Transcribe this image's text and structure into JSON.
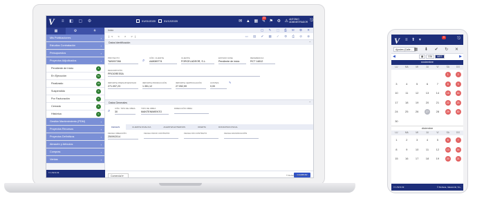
{
  "laptop": {
    "logo": "V",
    "toolbar_icons": "≡ ◧ ▢ ⚙",
    "date_from": "01/01/2020",
    "date_to": "31/12/2020",
    "notifications_badge": "23",
    "user_name": "ANTONIO",
    "user_role": "ADMINISTRADOR",
    "side_tabs": [
      "▦",
      "⚙",
      "⚘"
    ],
    "menu": [
      {
        "label": "Mis Publicaciones",
        "type": "grp"
      },
      {
        "label": "Estudios Contratación",
        "type": "grp"
      },
      {
        "label": "Presupuestos",
        "type": "grp"
      },
      {
        "label": "Proyectos Adjudicados",
        "type": "grp"
      },
      {
        "label": "Pendiente de Inicio",
        "type": "sub",
        "count": "4",
        "color": "#2e7d32"
      },
      {
        "label": "En Ejecución",
        "type": "sub",
        "count": "51",
        "color": "#2e7d32"
      },
      {
        "label": "Finalizado",
        "type": "sub",
        "count": "23",
        "color": "#2e7d32"
      },
      {
        "label": "Suspendido",
        "type": "sub",
        "count": "0",
        "color": "#2e7d32"
      },
      {
        "label": "Por Facturación",
        "type": "sub",
        "count": "0",
        "color": "#2e7d32"
      },
      {
        "label": "Cerrada",
        "type": "sub",
        "count": "3",
        "color": "#2e7d32"
      },
      {
        "label": "Histórica",
        "type": "sub",
        "count": "0",
        "color": "#2e7d32"
      },
      {
        "label": "Gestión Mantenimiento (PDM)",
        "type": "grp"
      },
      {
        "label": "Proyectos Recursos",
        "type": "grp"
      },
      {
        "label": "Proyectos Definitivos",
        "type": "grp"
      },
      {
        "label": "Almacén y Artículos",
        "type": "grp"
      },
      {
        "label": "Compras",
        "type": "grp"
      },
      {
        "label": "Ventas",
        "type": "grp"
      }
    ],
    "side_footer": "V 1.52.0.19",
    "breadcrumb": "Inicio",
    "nav_pager": "|< < > >|",
    "section_1": "Datos Identificación",
    "fields_1": [
      {
        "label": "PROYECTO",
        "value": "TAB007266"
      },
      {
        "label": "CÓD. CLIENTE",
        "value": "A48089774"
      },
      {
        "label": "CLIENTE",
        "value": "FORCELADEOR, S.L."
      },
      {
        "label": "ESTADO FASE",
        "value": "Pendiente de inicio"
      },
      {
        "label": "REFERENCIA",
        "value": "RCT 14812"
      },
      {
        "label": "DESCRIPCIÓN",
        "value": "PROGRESSA"
      },
      {
        "label": "IMPORTE PRESUPUESTADO",
        "value": "271.097,23"
      },
      {
        "label": "IMPORTE PRODUCCIÓN",
        "value": "1.351,12"
      },
      {
        "label": "IMPORTE CERTIFICACIÓN",
        "value": "27.052,59"
      },
      {
        "label": "COSTES",
        "value": "0,00"
      }
    ],
    "section_2": "Datos Generales",
    "fields_2": [
      {
        "label": "CÓD. TIPO DE OBRA",
        "value": "30"
      },
      {
        "label": "TIPO DE OBRA",
        "value": "MANTENIMIENTO"
      },
      {
        "label": "DIRECCIÓN OBRA",
        "value": ""
      }
    ],
    "subtabs": [
      "FECHAS",
      "CLIENTE FINAL/OA",
      "AGENTES EXTERNOS",
      "OFERTA",
      "DONANTES FISCAL"
    ],
    "fields_3": [
      {
        "label": "FECHA CREACIÓN",
        "value": "25/09/2014"
      },
      {
        "label": "FECHA INICIO CONTRATO",
        "value": ""
      },
      {
        "label": "FECHA FIN CONTRATO",
        "value": ""
      },
      {
        "label": "FECHA ADJUDICACIÓN",
        "value": ""
      }
    ],
    "bottom_select": "Comercial",
    "bottom_button": "GUARDAR",
    "footer_right": "© Dehesa, Ideacomit, S.L."
  },
  "phone": {
    "logo": "V",
    "icons": "≡ ⬆ ▾",
    "badge": "9",
    "select": "Ajustes (Calle...",
    "actions": "▦ ⬇ ✔ ↻ ✕",
    "modes": [
      "DÍA",
      "MES"
    ],
    "month1": "noviembre",
    "dows": [
      "LU",
      "MA",
      "MI",
      "JU",
      "VI",
      "SA",
      "DO"
    ],
    "month1_days": [
      {
        "d": "",
        "s": ""
      },
      {
        "d": "",
        "s": ""
      },
      {
        "d": "",
        "s": ""
      },
      {
        "d": "",
        "s": ""
      },
      {
        "d": "",
        "s": ""
      },
      {
        "d": "1",
        "s": "red"
      },
      {
        "d": "2",
        "s": "red"
      },
      {
        "d": "3",
        "s": ""
      },
      {
        "d": "4",
        "s": ""
      },
      {
        "d": "5",
        "s": ""
      },
      {
        "d": "6",
        "s": ""
      },
      {
        "d": "7",
        "s": ""
      },
      {
        "d": "8",
        "s": "red"
      },
      {
        "d": "9",
        "s": "red"
      },
      {
        "d": "10",
        "s": ""
      },
      {
        "d": "11",
        "s": ""
      },
      {
        "d": "12",
        "s": ""
      },
      {
        "d": "13",
        "s": ""
      },
      {
        "d": "14",
        "s": ""
      },
      {
        "d": "15",
        "s": "red"
      },
      {
        "d": "16",
        "s": "red"
      },
      {
        "d": "17",
        "s": ""
      },
      {
        "d": "18",
        "s": ""
      },
      {
        "d": "19",
        "s": ""
      },
      {
        "d": "20",
        "s": ""
      },
      {
        "d": "21",
        "s": ""
      },
      {
        "d": "22",
        "s": "red"
      },
      {
        "d": "23",
        "s": "red"
      },
      {
        "d": "24",
        "s": ""
      },
      {
        "d": "25",
        "s": ""
      },
      {
        "d": "26",
        "s": ""
      },
      {
        "d": "27",
        "s": "grey"
      },
      {
        "d": "28",
        "s": ""
      },
      {
        "d": "29",
        "s": "red"
      },
      {
        "d": "30",
        "s": "red"
      },
      {
        "d": "30",
        "s": ""
      },
      {
        "d": "",
        "s": ""
      },
      {
        "d": "",
        "s": ""
      },
      {
        "d": "",
        "s": ""
      },
      {
        "d": "",
        "s": ""
      },
      {
        "d": "",
        "s": ""
      },
      {
        "d": "",
        "s": ""
      }
    ],
    "month2": "diciembre",
    "month2_days": [
      {
        "d": "1",
        "s": ""
      },
      {
        "d": "2",
        "s": ""
      },
      {
        "d": "3",
        "s": ""
      },
      {
        "d": "4",
        "s": ""
      },
      {
        "d": "5",
        "s": ""
      },
      {
        "d": "6",
        "s": "red"
      },
      {
        "d": "7",
        "s": "red"
      },
      {
        "d": "8",
        "s": ""
      },
      {
        "d": "9",
        "s": ""
      },
      {
        "d": "10",
        "s": ""
      },
      {
        "d": "11",
        "s": ""
      },
      {
        "d": "12",
        "s": ""
      },
      {
        "d": "13",
        "s": "red"
      },
      {
        "d": "14",
        "s": "red"
      },
      {
        "d": "15",
        "s": ""
      },
      {
        "d": "16",
        "s": ""
      },
      {
        "d": "17",
        "s": ""
      },
      {
        "d": "18",
        "s": ""
      },
      {
        "d": "19",
        "s": ""
      },
      {
        "d": "20",
        "s": "red"
      },
      {
        "d": "21",
        "s": "red"
      }
    ],
    "footer_left": "V 1.52.0.19",
    "footer_right": "© Dehesa, Ideacomit, S.L."
  }
}
